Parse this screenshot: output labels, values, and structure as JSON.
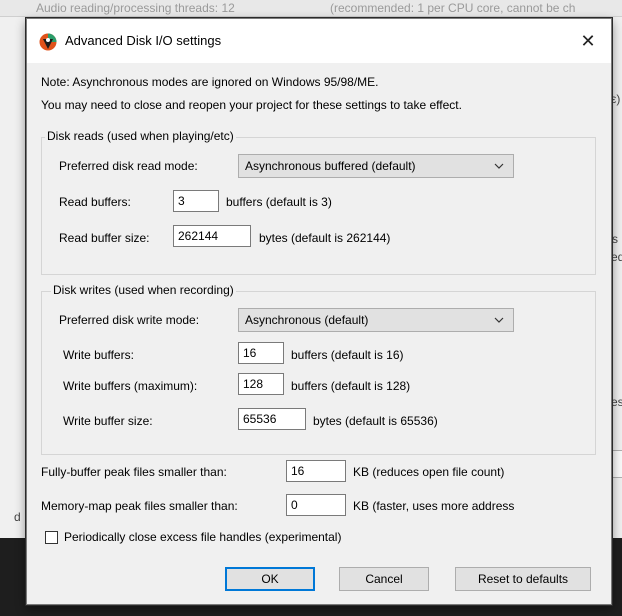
{
  "background": {
    "frag_top": "Audio reading/processing threads:  12",
    "frag_top2": "(recommended: 1 per CPU core, cannot be ch",
    "frag_r1": "ε)",
    "frag_r2": "s",
    "frag_r3": "ed",
    "frag_r4": "es",
    "frag_r5": "ot",
    "frag_l1": "d"
  },
  "dialog": {
    "title": "Advanced Disk I/O settings",
    "close_glyph": "✕",
    "note1": "Note: Asynchronous modes are ignored on Windows 95/98/ME.",
    "note2": "You may need to close and reopen your project for these settings to take effect."
  },
  "reads": {
    "legend": "Disk reads (used when playing/etc)",
    "mode_label": "Preferred disk read mode:",
    "mode_value": "Asynchronous buffered (default)",
    "buffers_label": "Read buffers:",
    "buffers_value": "3",
    "buffers_hint": "buffers (default is 3)",
    "size_label": "Read buffer size:",
    "size_value": "262144",
    "size_hint": "bytes (default is 262144)"
  },
  "writes": {
    "legend": "Disk writes (used when recording)",
    "mode_label": "Preferred disk write mode:",
    "mode_value": "Asynchronous (default)",
    "buffers_label": "Write buffers:",
    "buffers_value": "16",
    "buffers_hint": "buffers (default is 16)",
    "max_label": "Write buffers (maximum):",
    "max_value": "128",
    "max_hint": "buffers (default is 128)",
    "size_label": "Write buffer size:",
    "size_value": "65536",
    "size_hint": "bytes (default is 65536)"
  },
  "peak": {
    "full_label": "Fully-buffer peak files smaller than:",
    "full_value": "16",
    "full_hint": "KB (reduces open file count)",
    "mmap_label": "Memory-map peak files smaller than:",
    "mmap_value": "0",
    "mmap_hint": "KB (faster, uses more address",
    "close_label": "Periodically close excess file handles (experimental)",
    "close_checked": false
  },
  "buttons": {
    "ok": "OK",
    "cancel": "Cancel",
    "reset": "Reset to defaults"
  },
  "colors": {
    "focus": "#0078d7",
    "icon_orange": "#e0521b",
    "icon_green": "#2a9d6a"
  }
}
